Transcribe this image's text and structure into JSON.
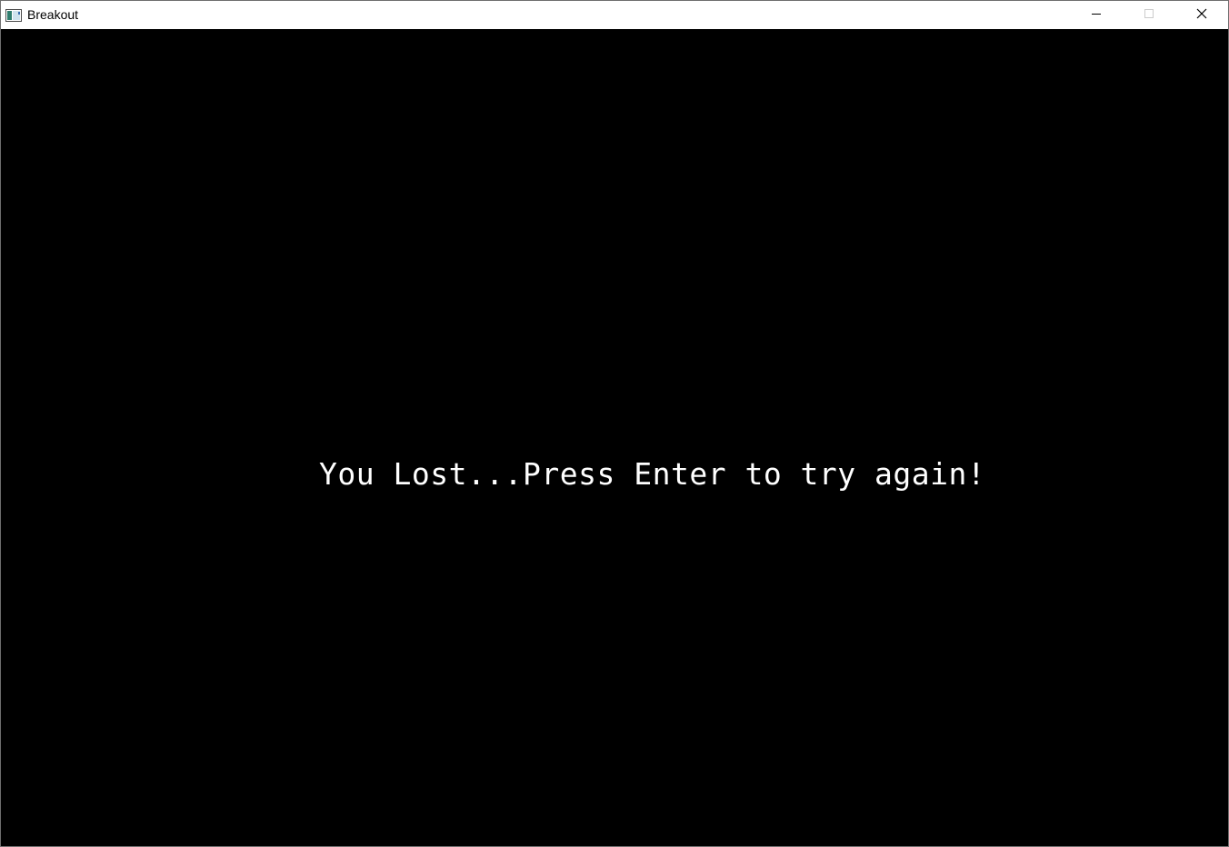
{
  "window": {
    "title": "Breakout"
  },
  "icons": {
    "app": "app-window-icon",
    "minimize": "minimize-icon",
    "maximize": "maximize-icon",
    "close": "close-icon"
  },
  "colors": {
    "background": "#000000",
    "text": "#ffffff",
    "titlebar": "#ffffff"
  },
  "game": {
    "message": "You Lost...Press Enter to try again!"
  }
}
